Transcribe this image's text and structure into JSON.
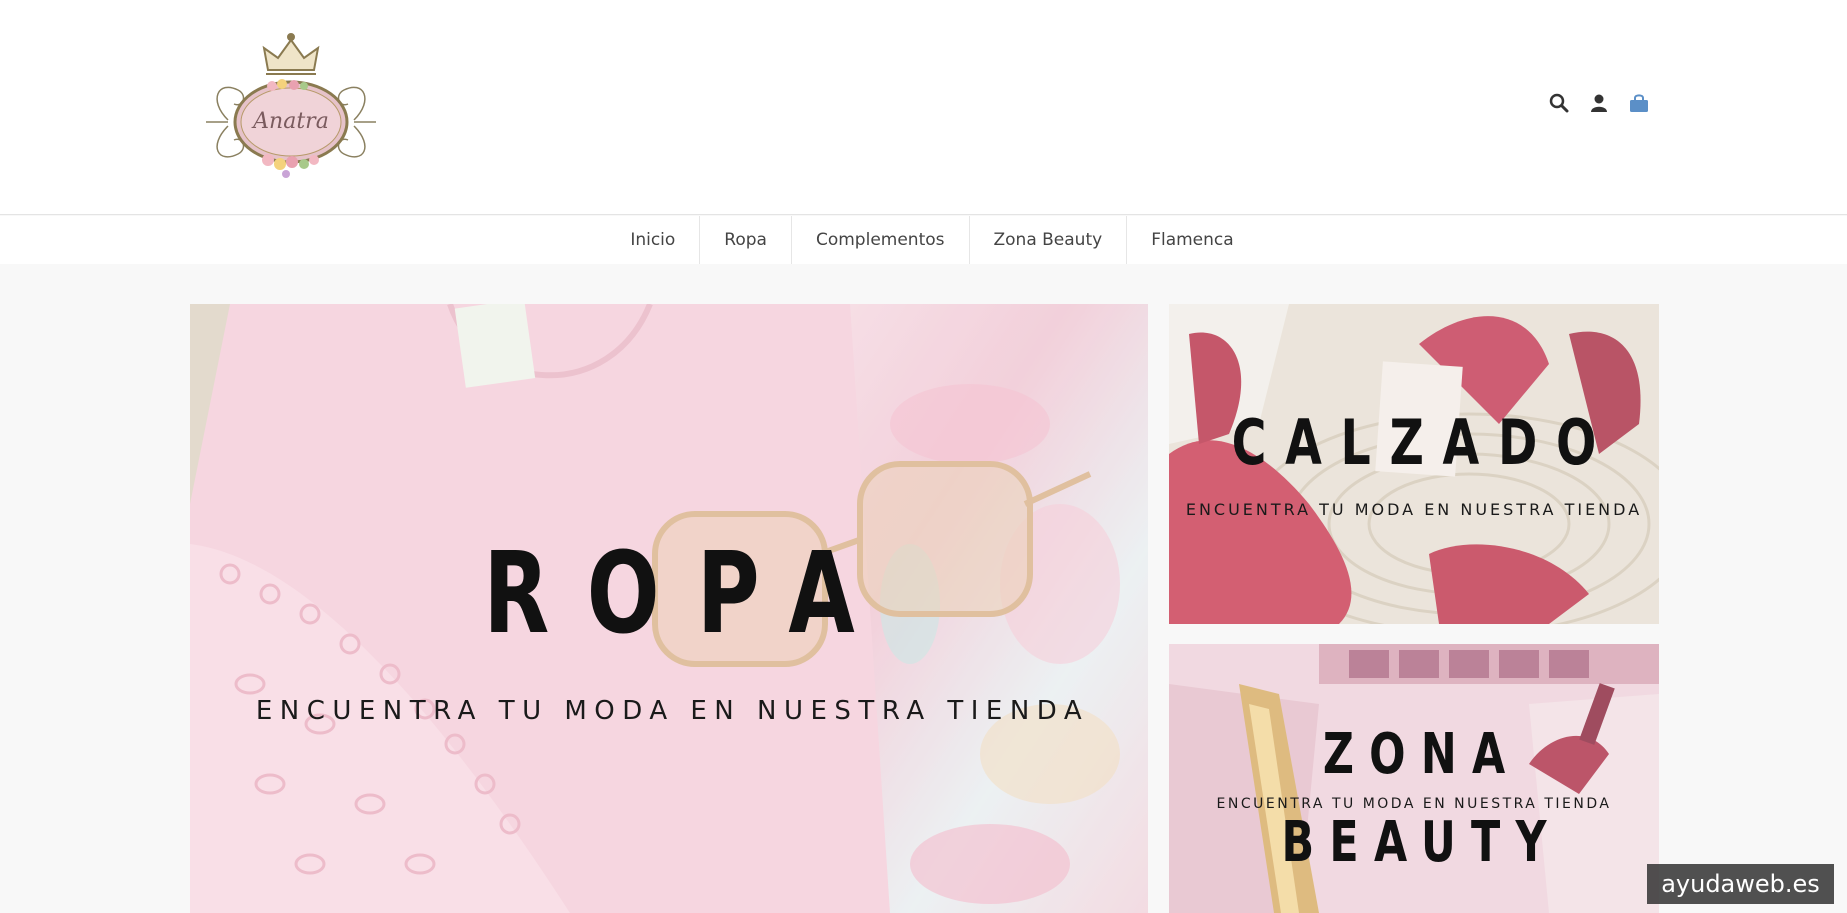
{
  "brand": {
    "logo_text": "Anatra"
  },
  "header": {
    "icons": [
      "search-icon",
      "user-icon",
      "shopping-bag-icon"
    ],
    "accent_color": "#5b8fc7"
  },
  "nav": {
    "items": [
      {
        "label": "Inicio"
      },
      {
        "label": "Ropa"
      },
      {
        "label": "Complementos"
      },
      {
        "label": "Zona Beauty"
      },
      {
        "label": "Flamenca"
      }
    ]
  },
  "banners": {
    "main": {
      "title": "ROPA",
      "subtitle": "ENCUENTRA TU MODA EN NUESTRA TIENDA"
    },
    "calzado": {
      "title": "CALZADO",
      "subtitle": "ENCUENTRA TU MODA EN NUESTRA TIENDA"
    },
    "beauty": {
      "title_line1": "ZONA",
      "subtitle": "ENCUENTRA TU MODA EN NUESTRA TIENDA",
      "title_line2": "BEAUTY"
    }
  },
  "watermark": {
    "text": "ayudaweb.es"
  }
}
